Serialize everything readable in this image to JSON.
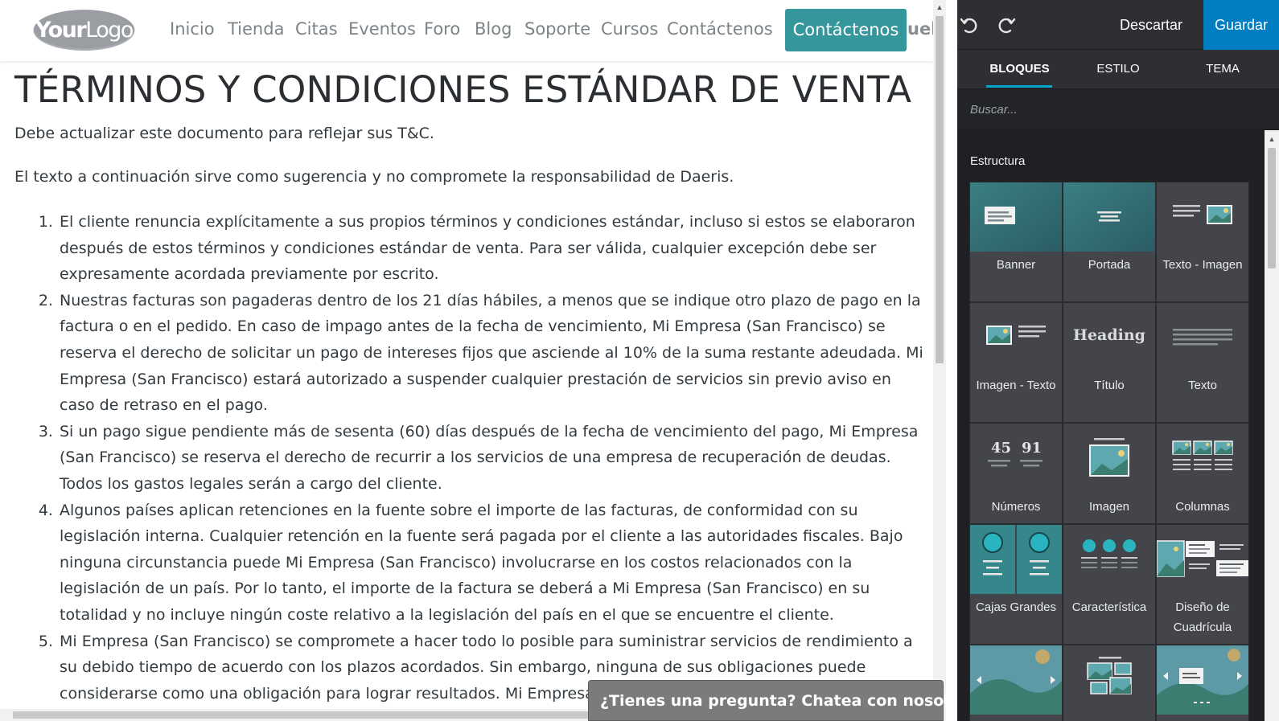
{
  "navbar": {
    "logo_bold": "Your",
    "logo_light": "Logo",
    "links": [
      "Inicio",
      "Tienda",
      "Citas",
      "Eventos",
      "Foro",
      "Blog",
      "Soporte",
      "Cursos",
      "Contáctenos"
    ],
    "cta": "Contáctenos",
    "user_partial": "uel A"
  },
  "page": {
    "title": "TÉRMINOS Y CONDICIONES ESTÁNDAR DE VENTA",
    "intro1": "Debe actualizar este documento para reflejar sus T&C.",
    "intro2": "El texto a continuación sirve como sugerencia y no compromete la responsabilidad de Daeris.",
    "terms": [
      "El cliente renuncia explícitamente a sus propios términos y condiciones estándar, incluso si estos se elaboraron después de estos términos y condiciones estándar de venta. Para ser válida, cualquier excepción debe ser expresamente acordada previamente por escrito.",
      "Nuestras facturas son pagaderas dentro de los 21 días hábiles, a menos que se indique otro plazo de pago en la factura o en el pedido. En caso de impago antes de la fecha de vencimiento, Mi Empresa (San Francisco) se reserva el derecho de solicitar un pago de intereses fijos que asciende al 10% de la suma restante adeudada. Mi Empresa (San Francisco) estará autorizado a suspender cualquier prestación de servicios sin previo aviso en caso de retraso en el pago.",
      "Si un pago sigue pendiente más de sesenta (60) días después de la fecha de vencimiento del pago, Mi Empresa (San Francisco) se reserva el derecho de recurrir a los servicios de una empresa de recuperación de deudas. Todos los gastos legales serán a cargo del cliente.",
      "Algunos países aplican retenciones en la fuente sobre el importe de las facturas, de conformidad con su legislación interna. Cualquier retención en la fuente será pagada por el cliente a las autoridades fiscales. Bajo ninguna circunstancia puede Mi Empresa (San Francisco) involucrarse en los costos relacionados con la legislación de un país. Por lo tanto, el importe de la factura se deberá a Mi Empresa (San Francisco) en su totalidad y no incluye ningún coste relativo a la legislación del país en el que se encuentre el cliente.",
      "Mi Empresa (San Francisco) se compromete a hacer todo lo posible para suministrar servicios de rendimiento a su debido tiempo de acuerdo con los plazos acordados. Sin embargo, ninguna de sus obligaciones puede considerarse como una obligación para lograr resultados. Mi Empresa"
    ]
  },
  "chat": {
    "label": "¿Tienes una pregunta? Chatea con nosotros."
  },
  "editor": {
    "undo_icon": "undo-icon",
    "redo_icon": "redo-icon",
    "discard": "Descartar",
    "save": "Guardar",
    "tabs": [
      "BLOQUES",
      "ESTILO",
      "TEMA"
    ],
    "active_tab": "BLOQUES",
    "search_placeholder": "Buscar...",
    "section": "Estructura",
    "blocks": [
      {
        "label": "Banner",
        "icon": "banner-icon"
      },
      {
        "label": "Portada",
        "icon": "cover-icon"
      },
      {
        "label": "Texto - Imagen",
        "icon": "text-image-icon"
      },
      {
        "label": "Imagen - Texto",
        "icon": "image-text-icon"
      },
      {
        "label": "Título",
        "icon": "heading-icon",
        "thumb_text": "Heading"
      },
      {
        "label": "Texto",
        "icon": "text-icon"
      },
      {
        "label": "Números",
        "icon": "numbers-icon",
        "thumb_numbers": [
          "45",
          "91"
        ]
      },
      {
        "label": "Imagen",
        "icon": "image-icon"
      },
      {
        "label": "Columnas",
        "icon": "columns-icon"
      },
      {
        "label": "Cajas Grandes",
        "icon": "big-boxes-icon"
      },
      {
        "label": "Característica",
        "icon": "features-icon"
      },
      {
        "label": "Diseño de Cuadrícula",
        "icon": "grid-layout-icon"
      },
      {
        "label": "",
        "icon": "carousel-icon"
      },
      {
        "label": "",
        "icon": "gallery-icon"
      },
      {
        "label": "",
        "icon": "slider-icon"
      }
    ]
  },
  "colors": {
    "brand_teal": "#35979c",
    "save_blue": "#017dc2",
    "panel_bg": "#2f3136",
    "tab_accent": "#00a7c9"
  }
}
